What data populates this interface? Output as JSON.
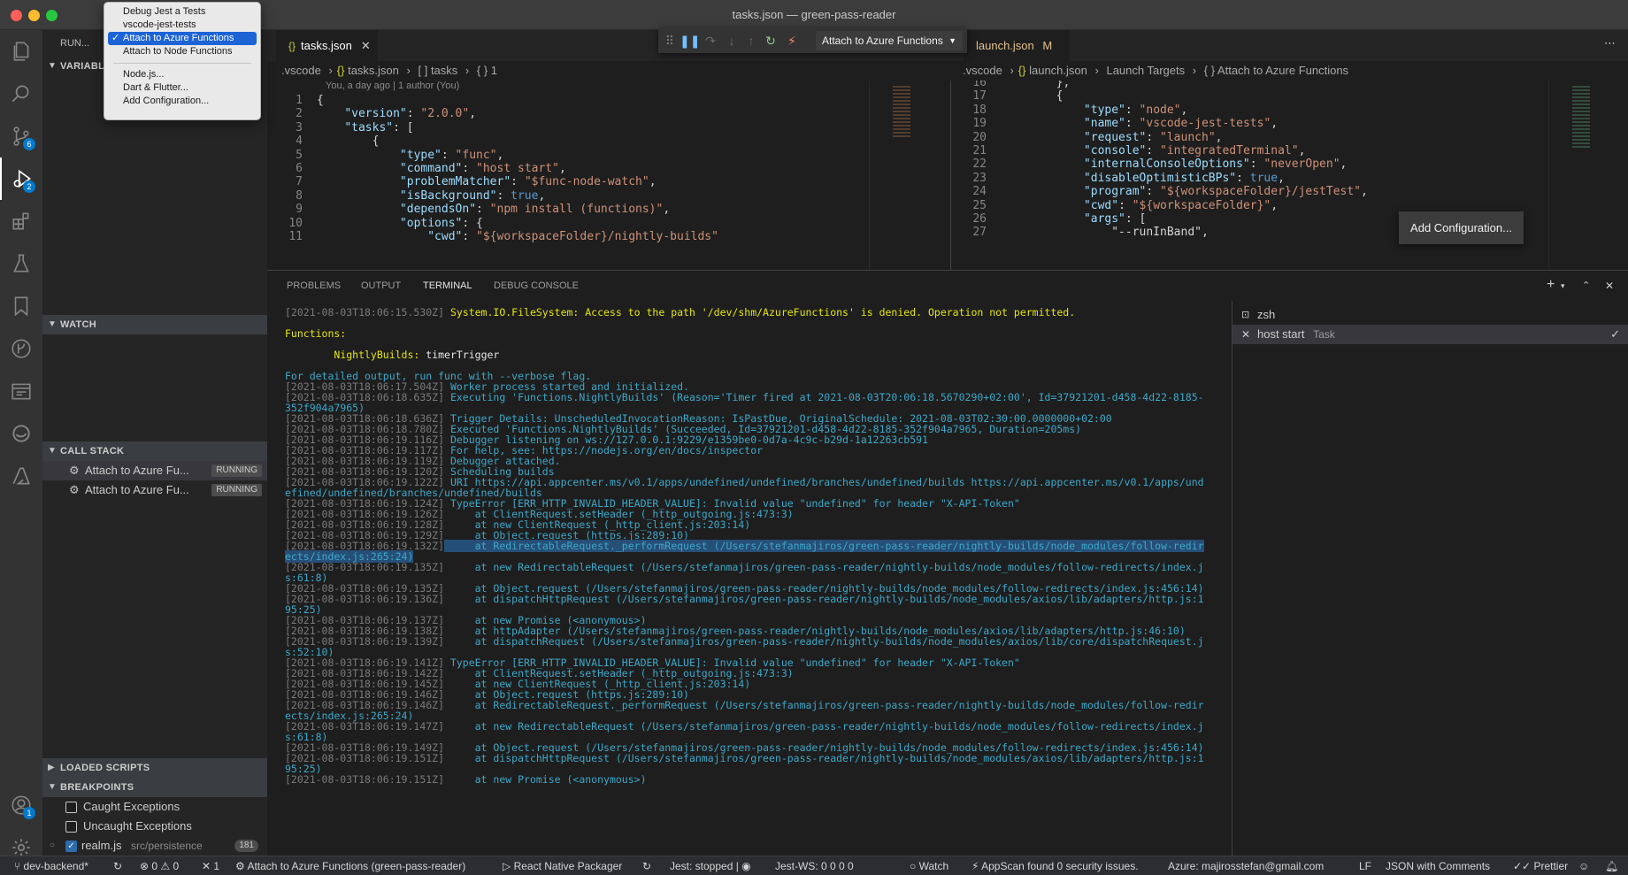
{
  "window": {
    "title": "tasks.json — green-pass-reader"
  },
  "colors": {
    "accent": "#007acc",
    "menu_selected": "#1c64d6",
    "titlebar": "#3c3c3c"
  },
  "activity_bar": {
    "items": [
      {
        "icon": "files-icon"
      },
      {
        "icon": "search-icon"
      },
      {
        "icon": "source-control-icon",
        "badge": "6"
      },
      {
        "icon": "run-debug-icon",
        "badge": "2"
      },
      {
        "icon": "extensions-icon"
      },
      {
        "icon": "testing-icon"
      },
      {
        "icon": "bookmark-icon"
      },
      {
        "icon": "git-graph-icon"
      },
      {
        "icon": "browser-icon"
      },
      {
        "icon": "edge-icon"
      },
      {
        "icon": "azure-icon"
      }
    ],
    "accounts_badge": "1"
  },
  "sidebar": {
    "run_label": "RUN...",
    "variables_label": "VARIABL",
    "watch_label": "WATCH",
    "call_stack_label": "CALL STACK",
    "call_stack": [
      {
        "label": "Attach to Azure Fu...",
        "status": "RUNNING"
      },
      {
        "label": "Attach to Azure Fu...",
        "status": "RUNNING"
      }
    ],
    "loaded_scripts_label": "LOADED SCRIPTS",
    "breakpoints_label": "BREAKPOINTS",
    "breakpoints": [
      {
        "label": "Caught Exceptions",
        "checked": false
      },
      {
        "label": "Uncaught Exceptions",
        "checked": false
      },
      {
        "label": "realm.js",
        "path": "src/persistence",
        "line": "181",
        "checked": true
      }
    ]
  },
  "launch_menu": {
    "items": [
      {
        "label": "Debug Jest a Tests",
        "selected": false
      },
      {
        "label": "vscode-jest-tests",
        "selected": false
      },
      {
        "label": "Attach to Azure Functions",
        "selected": true
      },
      {
        "label": "Attach to Node Functions",
        "selected": false
      }
    ],
    "extra": [
      "Node.js...",
      "Dart & Flutter...",
      "Add Configuration..."
    ]
  },
  "debug_toolbar": {
    "configuration": "Attach to Azure Functions"
  },
  "editor_left": {
    "tab": "tasks.json",
    "breadcrumb": [
      ".vscode",
      "tasks.json",
      "[ ] tasks",
      "{ } 1"
    ],
    "blame": "You, a day ago | 1 author (You)",
    "lines": [
      {
        "n": "1",
        "t": "{"
      },
      {
        "n": "2",
        "t": "    \"version\": \"2.0.0\","
      },
      {
        "n": "3",
        "t": "    \"tasks\": ["
      },
      {
        "n": "4",
        "t": "        {"
      },
      {
        "n": "5",
        "t": "            \"type\": \"func\","
      },
      {
        "n": "6",
        "t": "            \"command\": \"host start\","
      },
      {
        "n": "7",
        "t": "            \"problemMatcher\": \"$func-node-watch\","
      },
      {
        "n": "8",
        "t": "            \"isBackground\": true,"
      },
      {
        "n": "9",
        "t": "            \"dependsOn\": \"npm install (functions)\","
      },
      {
        "n": "10",
        "t": "            \"options\": {"
      },
      {
        "n": "11",
        "t": "                \"cwd\": \"${workspaceFolder}/nightly-builds\""
      }
    ]
  },
  "editor_right": {
    "tab": "launch.json",
    "tab_state": "M",
    "breadcrumb": [
      ".vscode",
      "launch.json",
      "Launch Targets",
      "{ } Attach to Azure Functions"
    ],
    "lines": [
      {
        "n": "16",
        "t": "        },"
      },
      {
        "n": "17",
        "t": "        {"
      },
      {
        "n": "18",
        "t": "            \"type\": \"node\","
      },
      {
        "n": "19",
        "t": "            \"name\": \"vscode-jest-tests\","
      },
      {
        "n": "20",
        "t": "            \"request\": \"launch\","
      },
      {
        "n": "21",
        "t": "            \"console\": \"integratedTerminal\","
      },
      {
        "n": "22",
        "t": "            \"internalConsoleOptions\": \"neverOpen\","
      },
      {
        "n": "23",
        "t": "            \"disableOptimisticBPs\": true,"
      },
      {
        "n": "24",
        "t": "            \"program\": \"${workspaceFolder}/jestTest\","
      },
      {
        "n": "25",
        "t": "            \"cwd\": \"${workspaceFolder}\","
      },
      {
        "n": "26",
        "t": "            \"args\": ["
      },
      {
        "n": "27",
        "t": "                \"--runInBand\","
      }
    ],
    "add_config_button": "Add Configuration..."
  },
  "panel": {
    "tabs": [
      "PROBLEMS",
      "OUTPUT",
      "TERMINAL",
      "DEBUG CONSOLE"
    ],
    "active_tab": "TERMINAL",
    "terminals": [
      {
        "label": "zsh",
        "sub": ""
      },
      {
        "label": "host start",
        "sub": "Task"
      }
    ],
    "terminal_lines": [
      {
        "ts": "[2021-08-03T18:06:15.530Z]",
        "msg": " System.IO.FileSystem: Access to the path '/dev/shm/AzureFunctions' is denied. Operation not permitted.",
        "style": "y"
      },
      {
        "ts": "",
        "msg": "",
        "style": ""
      },
      {
        "ts": "",
        "msg": "Functions:",
        "style": "y"
      },
      {
        "ts": "",
        "msg": "",
        "style": ""
      },
      {
        "ts": "",
        "msg": "        NightlyBuilds: timerTrigger",
        "style": "fn"
      },
      {
        "ts": "",
        "msg": "",
        "style": ""
      },
      {
        "ts": "",
        "msg": "For detailed output, run func with --verbose flag.",
        "style": ""
      },
      {
        "ts": "[2021-08-03T18:06:17.504Z]",
        "msg": " Worker process started and initialized.",
        "style": ""
      },
      {
        "ts": "[2021-08-03T18:06:18.635Z]",
        "msg": " Executing 'Functions.NightlyBuilds' (Reason='Timer fired at 2021-08-03T20:06:18.5670290+02:00', Id=37921201-d458-4d22-8185-",
        "style": ""
      },
      {
        "ts": "",
        "msg": "352f904a7965)",
        "style": ""
      },
      {
        "ts": "[2021-08-03T18:06:18.636Z]",
        "msg": " Trigger Details: UnscheduledInvocationReason: IsPastDue, OriginalSchedule: 2021-08-03T02:30:00.0000000+02:00",
        "style": ""
      },
      {
        "ts": "[2021-08-03T18:06:18.780Z]",
        "msg": " Executed 'Functions.NightlyBuilds' (Succeeded, Id=37921201-d458-4d22-8185-352f904a7965, Duration=205ms)",
        "style": ""
      },
      {
        "ts": "[2021-08-03T18:06:19.116Z]",
        "msg": " Debugger listening on ws://127.0.0.1:9229/e1359be0-0d7a-4c9c-b29d-1a12263cb591",
        "style": ""
      },
      {
        "ts": "[2021-08-03T18:06:19.117Z]",
        "msg": " For help, see: https://nodejs.org/en/docs/inspector",
        "style": ""
      },
      {
        "ts": "[2021-08-03T18:06:19.119Z]",
        "msg": " Debugger attached.",
        "style": ""
      },
      {
        "ts": "[2021-08-03T18:06:19.120Z]",
        "msg": " Scheduling builds",
        "style": ""
      },
      {
        "ts": "[2021-08-03T18:06:19.122Z]",
        "msg": " URI https://api.appcenter.ms/v0.1/apps/undefined/undefined/branches/undefined/builds https://api.appcenter.ms/v0.1/apps/und",
        "style": ""
      },
      {
        "ts": "",
        "msg": "efined/undefined/branches/undefined/builds",
        "style": ""
      },
      {
        "ts": "[2021-08-03T18:06:19.124Z]",
        "msg": " TypeError [ERR_HTTP_INVALID_HEADER_VALUE]: Invalid value \"undefined\" for header \"X-API-Token\"",
        "style": ""
      },
      {
        "ts": "[2021-08-03T18:06:19.126Z]",
        "msg": "     at ClientRequest.setHeader (_http_outgoing.js:473:3)",
        "style": ""
      },
      {
        "ts": "[2021-08-03T18:06:19.128Z]",
        "msg": "     at new ClientRequest (_http_client.js:203:14)",
        "style": ""
      },
      {
        "ts": "[2021-08-03T18:06:19.129Z]",
        "msg": "     at Object.request (https.js:289:10)",
        "style": ""
      },
      {
        "ts": "[2021-08-03T18:06:19.132Z]",
        "msg": "     at RedirectableRequest._performRequest (/Users/stefanmajiros/green-pass-reader/nightly-builds/node_modules/follow-redir",
        "style": "hl"
      },
      {
        "ts": "",
        "msg": "ects/index.js:265:24)",
        "style": "hl"
      },
      {
        "ts": "[2021-08-03T18:06:19.135Z]",
        "msg": "     at new RedirectableRequest (/Users/stefanmajiros/green-pass-reader/nightly-builds/node_modules/follow-redirects/index.j",
        "style": ""
      },
      {
        "ts": "",
        "msg": "s:61:8)",
        "style": ""
      },
      {
        "ts": "[2021-08-03T18:06:19.135Z]",
        "msg": "     at Object.request (/Users/stefanmajiros/green-pass-reader/nightly-builds/node_modules/follow-redirects/index.js:456:14)",
        "style": ""
      },
      {
        "ts": "[2021-08-03T18:06:19.136Z]",
        "msg": "     at dispatchHttpRequest (/Users/stefanmajiros/green-pass-reader/nightly-builds/node_modules/axios/lib/adapters/http.js:1",
        "style": ""
      },
      {
        "ts": "",
        "msg": "95:25)",
        "style": ""
      },
      {
        "ts": "[2021-08-03T18:06:19.137Z]",
        "msg": "     at new Promise (<anonymous>)",
        "style": ""
      },
      {
        "ts": "[2021-08-03T18:06:19.138Z]",
        "msg": "     at httpAdapter (/Users/stefanmajiros/green-pass-reader/nightly-builds/node_modules/axios/lib/adapters/http.js:46:10)",
        "style": ""
      },
      {
        "ts": "[2021-08-03T18:06:19.139Z]",
        "msg": "     at dispatchRequest (/Users/stefanmajiros/green-pass-reader/nightly-builds/node_modules/axios/lib/core/dispatchRequest.j",
        "style": ""
      },
      {
        "ts": "",
        "msg": "s:52:10)",
        "style": ""
      },
      {
        "ts": "[2021-08-03T18:06:19.141Z]",
        "msg": " TypeError [ERR_HTTP_INVALID_HEADER_VALUE]: Invalid value \"undefined\" for header \"X-API-Token\"",
        "style": ""
      },
      {
        "ts": "[2021-08-03T18:06:19.142Z]",
        "msg": "     at ClientRequest.setHeader (_http_outgoing.js:473:3)",
        "style": ""
      },
      {
        "ts": "[2021-08-03T18:06:19.145Z]",
        "msg": "     at new ClientRequest (_http_client.js:203:14)",
        "style": ""
      },
      {
        "ts": "[2021-08-03T18:06:19.146Z]",
        "msg": "     at Object.request (https.js:289:10)",
        "style": ""
      },
      {
        "ts": "[2021-08-03T18:06:19.146Z]",
        "msg": "     at RedirectableRequest._performRequest (/Users/stefanmajiros/green-pass-reader/nightly-builds/node_modules/follow-redir",
        "style": ""
      },
      {
        "ts": "",
        "msg": "ects/index.js:265:24)",
        "style": ""
      },
      {
        "ts": "[2021-08-03T18:06:19.147Z]",
        "msg": "     at new RedirectableRequest (/Users/stefanmajiros/green-pass-reader/nightly-builds/node_modules/follow-redirects/index.j",
        "style": ""
      },
      {
        "ts": "",
        "msg": "s:61:8)",
        "style": ""
      },
      {
        "ts": "[2021-08-03T18:06:19.149Z]",
        "msg": "     at Object.request (/Users/stefanmajiros/green-pass-reader/nightly-builds/node_modules/follow-redirects/index.js:456:14)",
        "style": ""
      },
      {
        "ts": "[2021-08-03T18:06:19.151Z]",
        "msg": "     at dispatchHttpRequest (/Users/stefanmajiros/green-pass-reader/nightly-builds/node_modules/axios/lib/adapters/http.js:1",
        "style": ""
      },
      {
        "ts": "",
        "msg": "95:25)",
        "style": ""
      },
      {
        "ts": "[2021-08-03T18:06:19.151Z]",
        "msg": "     at new Promise (<anonymous>)",
        "style": ""
      }
    ]
  },
  "statusbar": {
    "branch": "dev-backend*",
    "errors": "0",
    "warnings": "0",
    "tools": "1",
    "debug_session": "Attach to Azure Functions (green-pass-reader)",
    "packager": "React Native Packager",
    "jest": "Jest: stopped |",
    "jest_ws": "Jest-WS:",
    "jest_ws_counts": "0  0  0  0",
    "watch": "Watch",
    "appscan": "AppScan found 0 security issues.",
    "azure": "Azure: majirosstefan@gmail.com",
    "eol": "LF",
    "language": "JSON with Comments",
    "prettier": "Prettier"
  }
}
